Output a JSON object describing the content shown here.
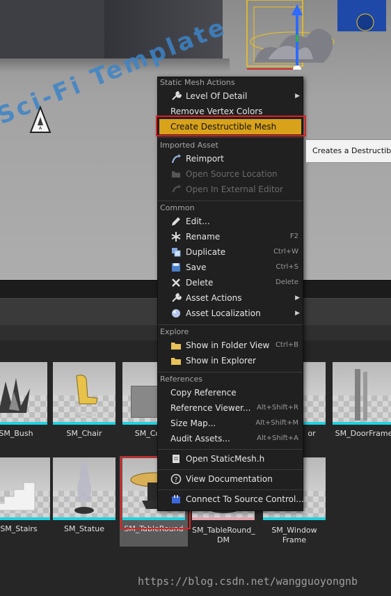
{
  "viewport": {
    "marker_letter": "A",
    "floor_text": "Sci-Fi Template"
  },
  "menu": {
    "sections": [
      {
        "header": "Static Mesh Actions",
        "items": [
          {
            "label": "Level Of Detail",
            "icon": "wrench-icon",
            "submenu": true
          },
          {
            "label": "Remove Vertex Colors"
          },
          {
            "label": "Create Destructible Mesh",
            "highlighted": true
          }
        ]
      },
      {
        "header": "Imported Asset",
        "items": [
          {
            "label": "Reimport",
            "icon": "reimport-icon"
          },
          {
            "label": "Open Source Location",
            "icon": "folder-open-icon",
            "disabled": true
          },
          {
            "label": "Open In External Editor",
            "icon": "external-editor-icon",
            "disabled": true
          }
        ]
      },
      {
        "header": "Common",
        "items": [
          {
            "label": "Edit...",
            "icon": "edit-icon"
          },
          {
            "label": "Rename",
            "icon": "rename-icon",
            "shortcut": "F2"
          },
          {
            "label": "Duplicate",
            "icon": "duplicate-icon",
            "shortcut": "Ctrl+W"
          },
          {
            "label": "Save",
            "icon": "save-icon",
            "shortcut": "Ctrl+S"
          },
          {
            "label": "Delete",
            "icon": "delete-icon",
            "shortcut": "Delete"
          },
          {
            "label": "Asset Actions",
            "icon": "wrench-icon",
            "submenu": true
          },
          {
            "label": "Asset Localization",
            "icon": "globe-icon",
            "submenu": true
          }
        ]
      },
      {
        "header": "Explore",
        "items": [
          {
            "label": "Show in Folder View",
            "icon": "folder-icon",
            "shortcut": "Ctrl+B"
          },
          {
            "label": "Show in Explorer",
            "icon": "folder-icon"
          }
        ]
      },
      {
        "header": "References",
        "items": [
          {
            "label": "Copy Reference"
          },
          {
            "label": "Reference Viewer...",
            "shortcut": "Alt+Shift+R"
          },
          {
            "label": "Size Map...",
            "shortcut": "Alt+Shift+M"
          },
          {
            "label": "Audit Assets...",
            "shortcut": "Alt+Shift+A"
          }
        ]
      }
    ],
    "extra_items": [
      {
        "label": "Open StaticMesh.h",
        "icon": "code-icon"
      },
      {
        "label": "View Documentation",
        "icon": "help-icon"
      },
      {
        "label": "Connect To Source Control...",
        "icon": "source-control-icon"
      }
    ]
  },
  "tooltip": {
    "text": "Creates a Destructible"
  },
  "assets": {
    "row1": [
      {
        "label": "SM_Bush"
      },
      {
        "label": "SM_Chair"
      },
      {
        "label": "SM_Corne"
      },
      {
        "label": "or"
      },
      {
        "label": "SM_DoorFrame"
      }
    ],
    "row2": [
      {
        "label": "SM_Stairs"
      },
      {
        "label": "SM_Statue"
      },
      {
        "label": "SM_TableRound"
      },
      {
        "label": "SM_TableRound_\nDM"
      },
      {
        "label": "SM_Window\nFrame"
      }
    ]
  },
  "watermark": "https://blog.csdn.net/wangguoyongnb",
  "colors": {
    "highlight": "#d8a21a",
    "outline_red": "#e02020",
    "asset_bar": "#1fd3e0"
  }
}
